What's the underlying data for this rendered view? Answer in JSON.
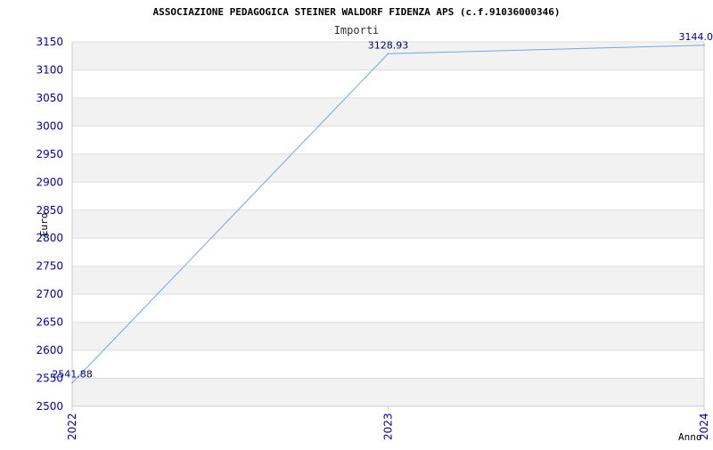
{
  "chart_data": {
    "type": "line",
    "title": "ASSOCIAZIONE PEDAGOGICA STEINER WALDORF FIDENZA APS (c.f.91036000346)",
    "subtitle": "Importi",
    "xlabel": "Anno",
    "ylabel": "Euro",
    "categories": [
      "2022",
      "2023",
      "2024"
    ],
    "series": [
      {
        "values": [
          2541.88,
          3128.93,
          3144.0
        ],
        "data_labels": [
          "2541.88",
          "3128.93",
          "3144.0"
        ]
      }
    ],
    "ylim": [
      2500,
      3150
    ],
    "yticks": [
      "2500",
      "2550",
      "2600",
      "2650",
      "2700",
      "2750",
      "2800",
      "2850",
      "2900",
      "2950",
      "3000",
      "3050",
      "3100",
      "3150"
    ],
    "grid": true,
    "colors": {
      "line": "#6fa8e8",
      "tick_labels": "#0000aa",
      "data_labels": "#000080",
      "band": "#f2f2f2",
      "grid": "#dddddd",
      "axis": "#cccccc",
      "title": "#000000",
      "subtitle": "#333333"
    }
  }
}
